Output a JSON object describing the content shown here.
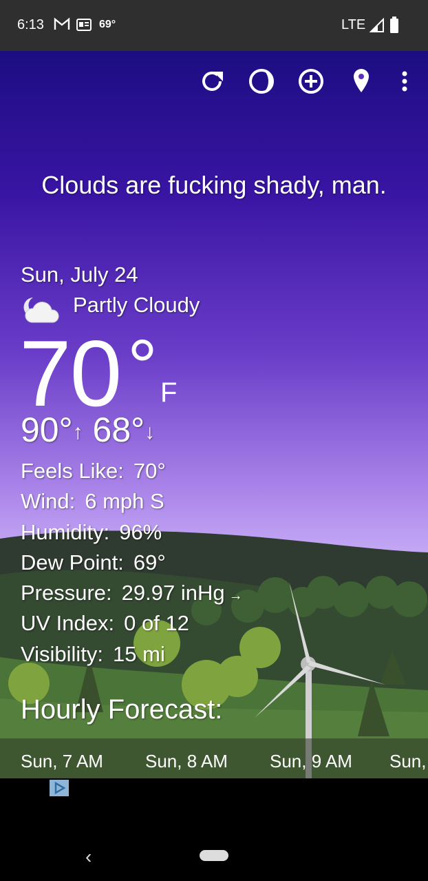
{
  "status_bar": {
    "time": "6:13",
    "temperature": "69°",
    "network": "LTE",
    "icons": [
      "gmail-icon",
      "news-icon",
      "signal-icon",
      "battery-icon"
    ]
  },
  "toolbar": {
    "icons": [
      "refresh-icon",
      "moon-phase-icon",
      "add-location-icon",
      "location-pin-icon",
      "more-options-icon"
    ]
  },
  "tagline": "Clouds are fucking shady, man.",
  "current": {
    "date": "Sun, July 24",
    "condition": "Partly Cloudy",
    "condition_icon": "partly-cloudy-night-icon",
    "temperature": "70",
    "degree_symbol": "°",
    "unit": "F",
    "high": "90°",
    "high_arrow": "↑",
    "low": "68°",
    "low_arrow": "↓"
  },
  "details": [
    {
      "label": "Feels Like:",
      "value": "70°",
      "suffix": ""
    },
    {
      "label": "Wind:",
      "value": "6 mph S",
      "suffix": ""
    },
    {
      "label": "Humidity:",
      "value": "96%",
      "suffix": ""
    },
    {
      "label": "Dew Point:",
      "value": "69°",
      "suffix": ""
    },
    {
      "label": "Pressure:",
      "value": "29.97 inHg",
      "suffix": "→"
    },
    {
      "label": "UV Index:",
      "value": "0 of 12",
      "suffix": ""
    },
    {
      "label": "Visibility:",
      "value": "15 mi",
      "suffix": ""
    }
  ],
  "hourly": {
    "title": "Hourly Forecast:",
    "items": [
      "Sun, 7 AM",
      "Sun, 8 AM",
      "Sun, 9 AM",
      "Sun,"
    ]
  },
  "colors": {
    "sky_top": "#1c0d82",
    "sky_bottom": "#c8b0f6",
    "hills": "#2f3a30",
    "grass": "#4f7a3a"
  },
  "nav": {
    "back_glyph": "‹"
  }
}
